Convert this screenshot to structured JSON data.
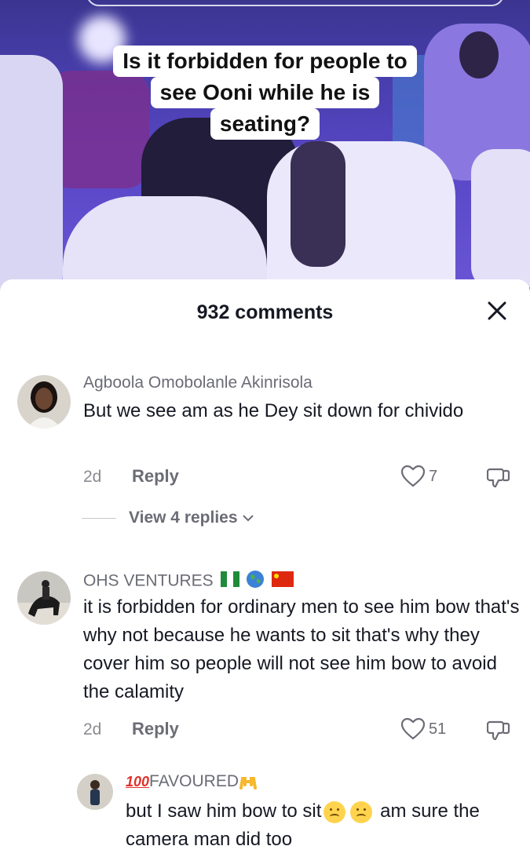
{
  "video": {
    "caption_lines": [
      "Is it forbidden for people to",
      "see Ooni while he is",
      "seating?"
    ]
  },
  "comments_sheet": {
    "title": "932 comments",
    "close_icon": "close-icon"
  },
  "comments": [
    {
      "username": "Agboola Omobolanle Akinrisola",
      "text": "But we see am as he Dey sit down for chivido",
      "age": "2d",
      "reply_label": "Reply",
      "likes": "7",
      "view_replies": "View 4 replies"
    },
    {
      "username": "OHS VENTURES",
      "username_flags": [
        "nigeria-flag",
        "globe-emoji",
        "china-flag"
      ],
      "text": "it is forbidden for ordinary men to see him bow that's why not because he wants to sit that's why they cover him so people will not see him bow to avoid the calamity",
      "age": "2d",
      "reply_label": "Reply",
      "likes": "51"
    }
  ],
  "replies": [
    {
      "username_prefix_icon": "100-emoji",
      "username": "FAVOURED",
      "username_suffix_icon": "raised-hands-emoji",
      "text_start": "but I saw him bow to sit",
      "text_emojis": [
        "woozy-face-emoji",
        "woozy-face-emoji"
      ],
      "text_end": " am sure the camera man did too"
    }
  ],
  "colors": {
    "text_primary": "#161823",
    "text_secondary": "#6b6c75",
    "like_outline": "#6b6c75"
  }
}
